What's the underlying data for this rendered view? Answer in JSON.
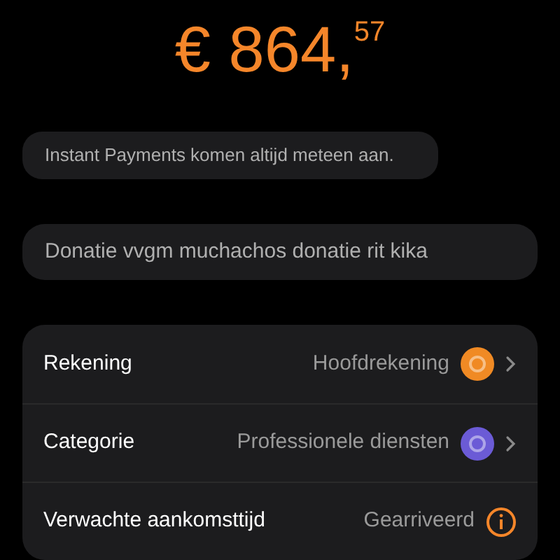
{
  "amount": {
    "currency": "€",
    "whole": "864,",
    "cents": "57"
  },
  "notice": "Instant Payments komen altijd meteen aan.",
  "description": "Donatie vvgm muchachos donatie rit kika",
  "details": [
    {
      "kind": "link",
      "label": "Rekening",
      "value": "Hoofdrekening",
      "color": "#f08a24"
    },
    {
      "kind": "link",
      "label": "Categorie",
      "value": "Professionele diensten",
      "color": "#6b5bd6"
    },
    {
      "kind": "info",
      "label": "Verwachte aankomsttijd",
      "value": "Gearriveerd"
    }
  ]
}
